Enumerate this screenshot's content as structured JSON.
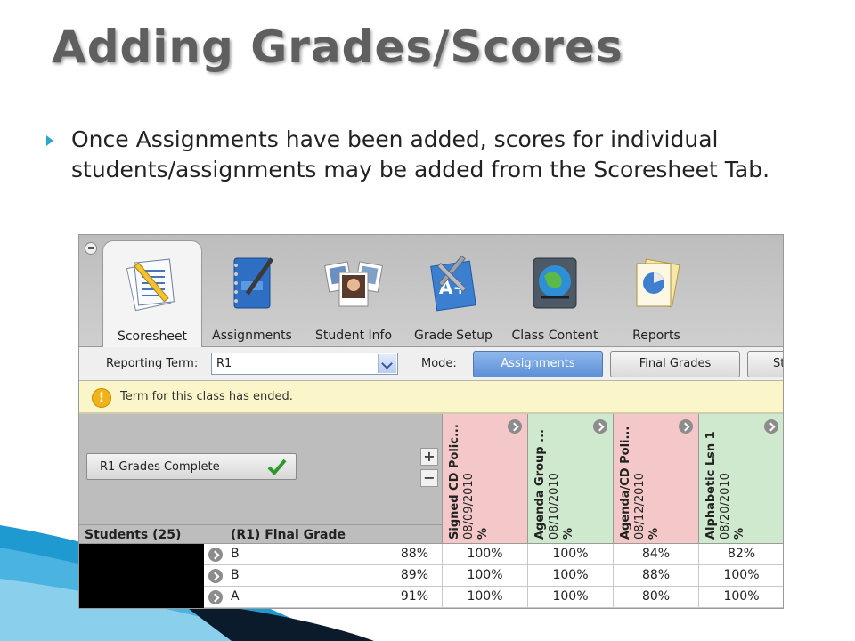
{
  "slide": {
    "title": "Adding Grades/Scores",
    "bullet": "Once Assignments have been added, scores for individual students/assignments may be added from the Scoresheet Tab."
  },
  "app": {
    "tabs": [
      {
        "label": "Scoresheet",
        "icon": "scoresheet-icon",
        "active": true
      },
      {
        "label": "Assignments",
        "icon": "notebook-icon",
        "active": false
      },
      {
        "label": "Student Info",
        "icon": "photos-icon",
        "active": false
      },
      {
        "label": "Grade Setup",
        "icon": "tools-icon",
        "active": false
      },
      {
        "label": "Class Content",
        "icon": "globe-book-icon",
        "active": false
      },
      {
        "label": "Reports",
        "icon": "report-chart-icon",
        "active": false
      }
    ],
    "toolbar": {
      "reporting_term_label": "Reporting Term:",
      "reporting_term_value": "R1",
      "mode_label": "Mode:",
      "mode_assignments": "Assignments",
      "mode_final_grades": "Final Grades",
      "mode_third": "St"
    },
    "notice": "Term for this class has ended.",
    "complete_button": "R1 Grades Complete",
    "plus": "+",
    "minus": "−",
    "columns": [
      {
        "name": "Signed CD Polic...",
        "date": "08/09/2010",
        "unit": "%",
        "color": "#f4c8c8"
      },
      {
        "name": "Agenda Group ...",
        "date": "08/10/2010",
        "unit": "%",
        "color": "#cfe9cf"
      },
      {
        "name": "Agenda/CD Poli...",
        "date": "08/12/2010",
        "unit": "%",
        "color": "#f4c8c8"
      },
      {
        "name": "Alphabetic Lsn 1",
        "date": "08/20/2010",
        "unit": "%",
        "color": "#cfe9cf"
      }
    ],
    "students_header": "Students (25)",
    "final_grade_header": "(R1) Final Grade",
    "rows": [
      {
        "letter": "B",
        "pct": "88%",
        "scores": [
          "100%",
          "100%",
          "84%",
          "82%"
        ]
      },
      {
        "letter": "B",
        "pct": "89%",
        "scores": [
          "100%",
          "100%",
          "88%",
          "100%"
        ]
      },
      {
        "letter": "A",
        "pct": "91%",
        "scores": [
          "100%",
          "100%",
          "80%",
          "100%"
        ]
      }
    ]
  },
  "colors": {
    "accent": "#2aa8c9",
    "active_mode": "#5c8fd6",
    "notice_bg": "#fbf6c9"
  }
}
